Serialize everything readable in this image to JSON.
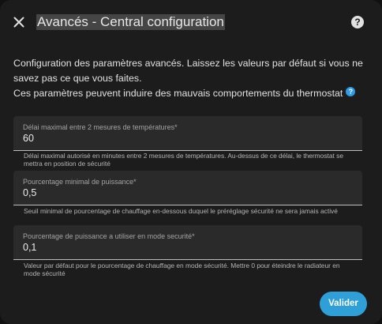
{
  "dialog": {
    "title": "Avancés - Central configuration",
    "help_glyph": "?",
    "close_icon": "close-icon",
    "help_icon": "help-icon"
  },
  "description": {
    "line1": "Configuration des paramètres avancés. Laissez les valeurs par défaut si vous ne savez pas ce que vous faites.",
    "line2": "Ces paramètres peuvent induire des mauvais comportements du thermostat",
    "info_glyph": "?",
    "info_icon": "info-icon",
    "info_color": "#2e9be6"
  },
  "fields": [
    {
      "label": "Délai maximal entre 2 mesures de températures*",
      "value": "60",
      "helper": "Délai maximal autorisé en minutes entre 2 mesures de températures. Au-dessus de ce délai, le thermostat se mettra en position de sécurité"
    },
    {
      "label": "Pourcentage minimal de puissance*",
      "value": "0,5",
      "helper": "Seuil minimal de pourcentage de chauffage en-dessous duquel le préréglage sécurité ne sera jamais activé"
    },
    {
      "label": "Pourcentage de puissance a utiliser en mode securité*",
      "value": "0,1",
      "helper": "Valeur par défaut pour le pourcentage de chauffage en mode sécurité. Mettre 0 pour éteindre le radiateur en mode sécurité"
    }
  ],
  "actions": {
    "submit_label": "Valider",
    "submit_color": "#2f9fd8"
  }
}
